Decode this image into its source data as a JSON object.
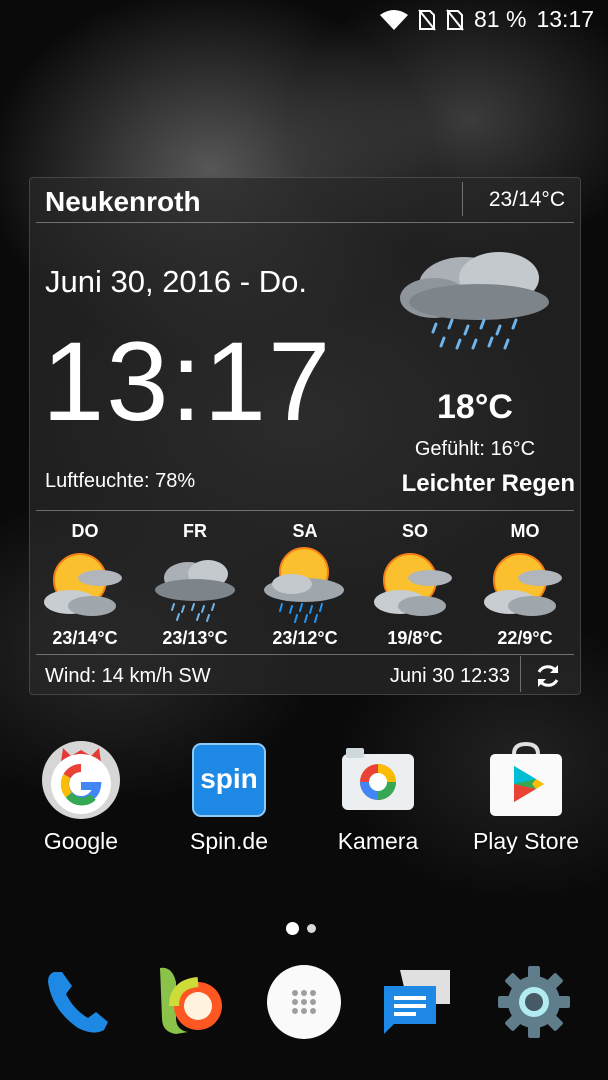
{
  "status_bar": {
    "battery": "81 %",
    "time": "13:17",
    "icons": [
      "wifi-icon",
      "no-sim-icon",
      "no-sim-icon"
    ]
  },
  "widget": {
    "city": "Neukenroth",
    "range": "23/14°C",
    "date": "Juni 30, 2016 - Do.",
    "time": "13:17",
    "humidity": "Luftfeuchte: 78%",
    "temperature": "18°C",
    "feels_like": "Gefühlt: 16°C",
    "condition": "Leichter Regen",
    "current_icon": "rain-cloud-icon",
    "forecast": [
      {
        "day": "DO",
        "temp": "23/14°C",
        "icon": "sun-cloud-icon"
      },
      {
        "day": "FR",
        "temp": "23/13°C",
        "icon": "rain-cloud-icon"
      },
      {
        "day": "SA",
        "temp": "23/12°C",
        "icon": "sun-rain-icon"
      },
      {
        "day": "SO",
        "temp": "19/8°C",
        "icon": "sun-cloud-icon"
      },
      {
        "day": "MO",
        "temp": "22/9°C",
        "icon": "sun-cloud-icon"
      }
    ],
    "wind": "Wind: 14 km/h SW",
    "updated": "Juni 30  12:33"
  },
  "apps": [
    {
      "label": "Google",
      "icon": "google-icon"
    },
    {
      "label": "Spin.de",
      "icon": "spin-icon"
    },
    {
      "label": "Kamera",
      "icon": "camera-icon"
    },
    {
      "label": "Play Store",
      "icon": "play-store-icon"
    }
  ],
  "spin_text": "spin",
  "dock": [
    "phone-icon",
    "browser-icon",
    "app-drawer-icon",
    "messages-icon",
    "settings-icon"
  ],
  "colors": {
    "accent_blue": "#1e88e5",
    "google_red": "#ea4335",
    "play_green": "#34a853",
    "sun_yellow": "#fbc02d"
  }
}
